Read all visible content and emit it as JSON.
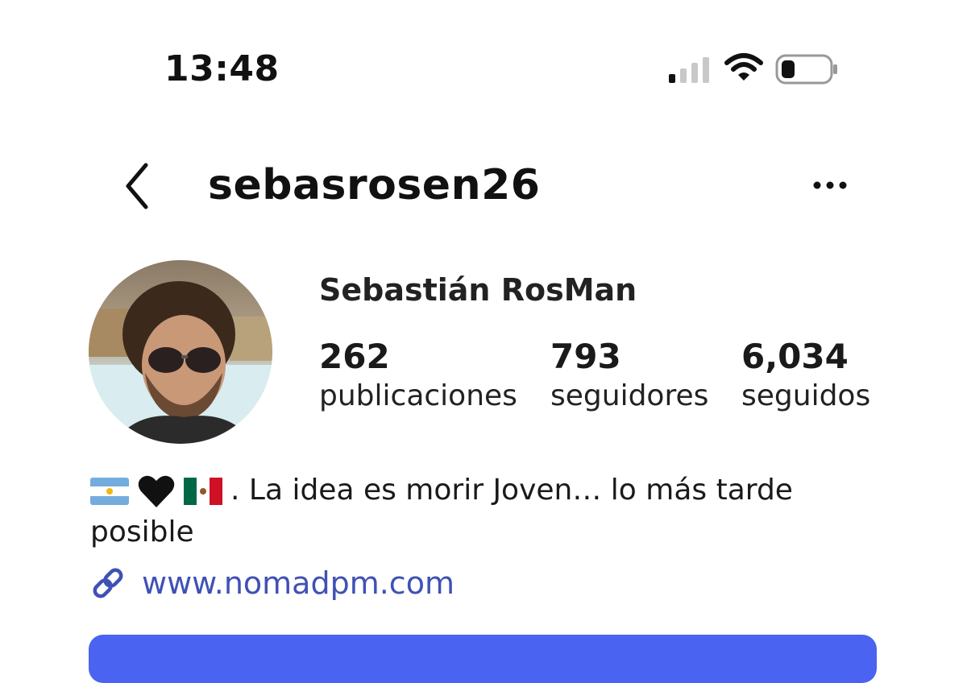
{
  "status_bar": {
    "time": "13:48",
    "icons": [
      "signal-icon",
      "wifi-icon",
      "battery-icon"
    ]
  },
  "header": {
    "username": "sebasrosen26",
    "icons": [
      "back-arrow-icon",
      "more-options-icon"
    ]
  },
  "profile": {
    "display_name": "Sebastián RosMan",
    "stats": [
      {
        "value": "262",
        "label": "publicaciones"
      },
      {
        "value": "793",
        "label": "seguidores"
      },
      {
        "value": "6,034",
        "label": "seguidos"
      }
    ],
    "bio_emojis": [
      "argentina-flag-icon",
      "black-heart-icon",
      "mexico-flag-icon"
    ],
    "bio_text": ". La idea es morir Joven… lo más tarde posible",
    "link": "www.nomadpm.com",
    "link_icon": "link-icon"
  },
  "colors": {
    "link": "#3f51b5",
    "cta": "#4a63f0"
  }
}
